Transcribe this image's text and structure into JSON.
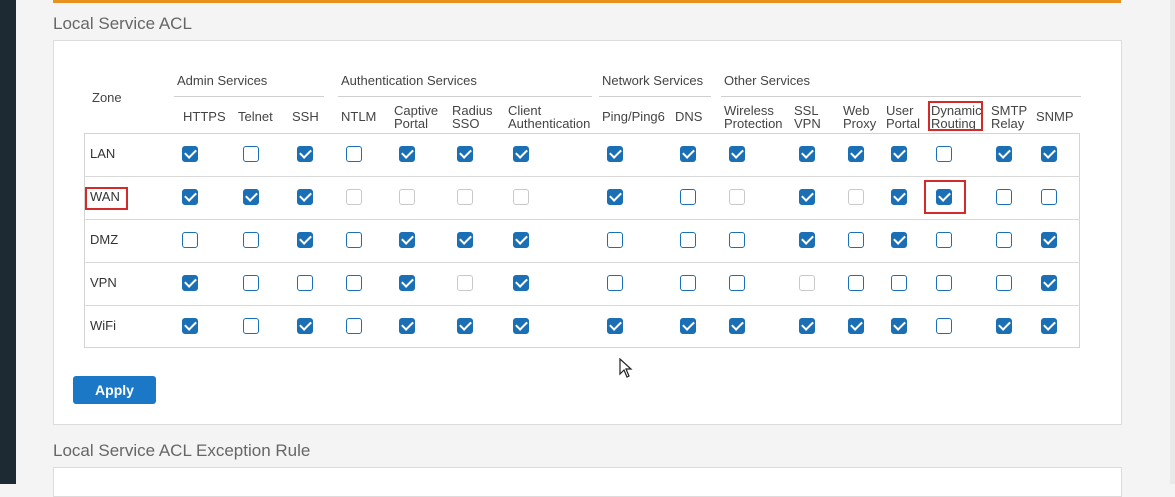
{
  "section1_title": "Local Service ACL",
  "section2_title": "Local Service ACL Exception Rule",
  "zone_header": "Zone",
  "groups": {
    "admin": "Admin Services",
    "auth": "Authentication Services",
    "network": "Network Services",
    "other": "Other Services"
  },
  "columns": [
    {
      "l1": "HTTPS",
      "l2": ""
    },
    {
      "l1": "Telnet",
      "l2": ""
    },
    {
      "l1": "SSH",
      "l2": ""
    },
    {
      "l1": "NTLM",
      "l2": ""
    },
    {
      "l1": "Captive",
      "l2": "Portal"
    },
    {
      "l1": "Radius",
      "l2": "SSO"
    },
    {
      "l1": "Client",
      "l2": "Authentication"
    },
    {
      "l1": "Ping/Ping6",
      "l2": ""
    },
    {
      "l1": "DNS",
      "l2": ""
    },
    {
      "l1": "Wireless",
      "l2": "Protection"
    },
    {
      "l1": "SSL",
      "l2": "VPN"
    },
    {
      "l1": "Web",
      "l2": "Proxy"
    },
    {
      "l1": "User",
      "l2": "Portal"
    },
    {
      "l1": "Dynamic",
      "l2": "Routing"
    },
    {
      "l1": "SMTP",
      "l2": "Relay"
    },
    {
      "l1": "SNMP",
      "l2": ""
    }
  ],
  "zones": [
    {
      "name": "LAN",
      "states": [
        "c",
        "u",
        "c",
        "u",
        "c",
        "c",
        "c",
        "c",
        "c",
        "c",
        "c",
        "c",
        "c",
        "u",
        "c",
        "c"
      ]
    },
    {
      "name": "WAN",
      "states": [
        "c",
        "c",
        "c",
        "d",
        "d",
        "d",
        "d",
        "c",
        "u",
        "d",
        "c",
        "d",
        "c",
        "c",
        "u",
        "u"
      ]
    },
    {
      "name": "DMZ",
      "states": [
        "u",
        "u",
        "c",
        "u",
        "c",
        "c",
        "c",
        "u",
        "u",
        "u",
        "c",
        "u",
        "c",
        "u",
        "u",
        "c"
      ]
    },
    {
      "name": "VPN",
      "states": [
        "c",
        "u",
        "u",
        "u",
        "c",
        "d",
        "c",
        "u",
        "u",
        "u",
        "d",
        "u",
        "u",
        "u",
        "u",
        "c"
      ]
    },
    {
      "name": "WiFi",
      "states": [
        "c",
        "u",
        "c",
        "u",
        "c",
        "c",
        "c",
        "c",
        "c",
        "c",
        "c",
        "c",
        "c",
        "u",
        "c",
        "c"
      ]
    }
  ],
  "apply_label": "Apply"
}
